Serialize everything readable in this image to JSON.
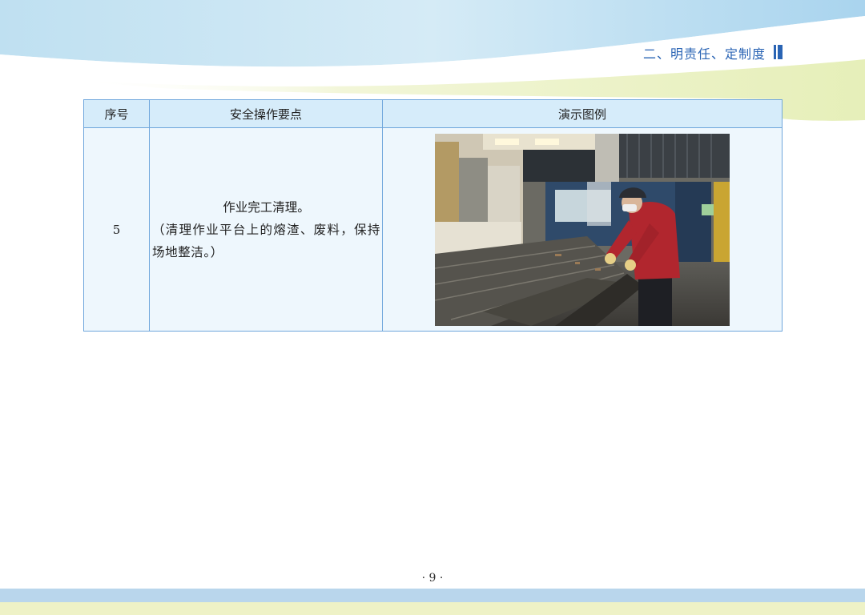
{
  "header": {
    "chapter_title": "二、明责任、定制度"
  },
  "table": {
    "columns": [
      "序号",
      "安全操作要点",
      "演示图例"
    ],
    "rows": [
      {
        "number": "5",
        "point_title": "作业完工清理。",
        "point_note": "（清理作业平台上的熔渣、废料，保持场地整洁。）",
        "image_description": "photo-worker-cleaning-platform"
      }
    ]
  },
  "footer": {
    "page_number": "· 9 ·"
  },
  "colors": {
    "heading_blue": "#2a64b4",
    "table_border": "#6fa6dc",
    "header_fill": "#d6ecfa",
    "cell_fill": "#eef7fd",
    "band_blue": "#b9d6ec",
    "band_yellow": "#eef2c6"
  }
}
